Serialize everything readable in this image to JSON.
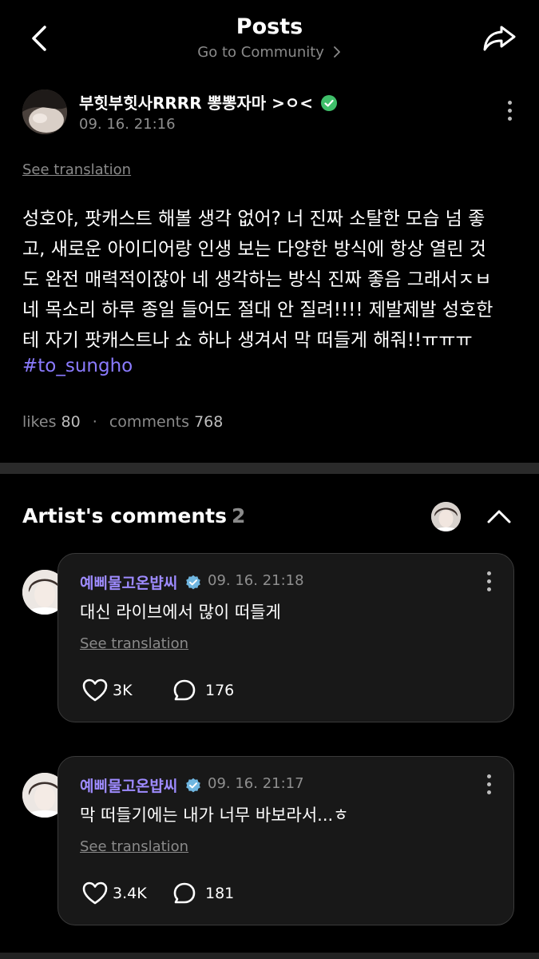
{
  "header": {
    "title": "Posts",
    "subtitle": "Go to Community",
    "back_icon": "chevron-left-icon",
    "share_icon": "share-icon"
  },
  "post": {
    "author": "부힛부힛사RRRR 뽕뽕자마 >ㅇ<",
    "date": "09. 16. 21:16",
    "see_translation": "See translation",
    "body_lines": [
      "성호야, 팟캐스트 해볼 생각 없어? 너 진짜 소탈한 모습 넘 좋",
      "고, 새로운 아이디어랑 인생 보는 다양한 방식에 항상 열린 것",
      "도 완전 매력적이잖아 네 생각하는 방식 진짜 좋음 그래서ㅈㅂ",
      "네 목소리 하루 종일 들어도 절대 안 질려!!!! 제발제발 성호한",
      "테 자기 팟캐스트나 쇼 하나 생겨서 막 떠들게 해줘!!ㅠㅠㅠ"
    ],
    "hashtag": "#to_sungho",
    "likes_label": "likes",
    "likes": "80",
    "comments_label": "comments",
    "comments": "768"
  },
  "artist_comments": {
    "title": "Artist's comments",
    "count": "2",
    "items": [
      {
        "author": "예삐물고온뱝씨",
        "date": "09. 16. 21:18",
        "text": "대신 라이브에서 많이 떠들게",
        "see_translation": "See translation",
        "likes": "3K",
        "comments": "176"
      },
      {
        "author": "예삐물고온뱝씨",
        "date": "09. 16. 21:17",
        "text": "막 떠들기에는 내가 너무 바보라서...ㅎ",
        "see_translation": "See translation",
        "likes": "3.4K",
        "comments": "181"
      }
    ]
  },
  "colors": {
    "background": "#000000",
    "accent_purple": "#9e8bff",
    "hashtag": "#8b7bff",
    "verified_green": "#3fbf6a",
    "verified_blue": "#6fb6e0",
    "card_bg": "#181818",
    "muted_text": "#8a8a8a"
  }
}
